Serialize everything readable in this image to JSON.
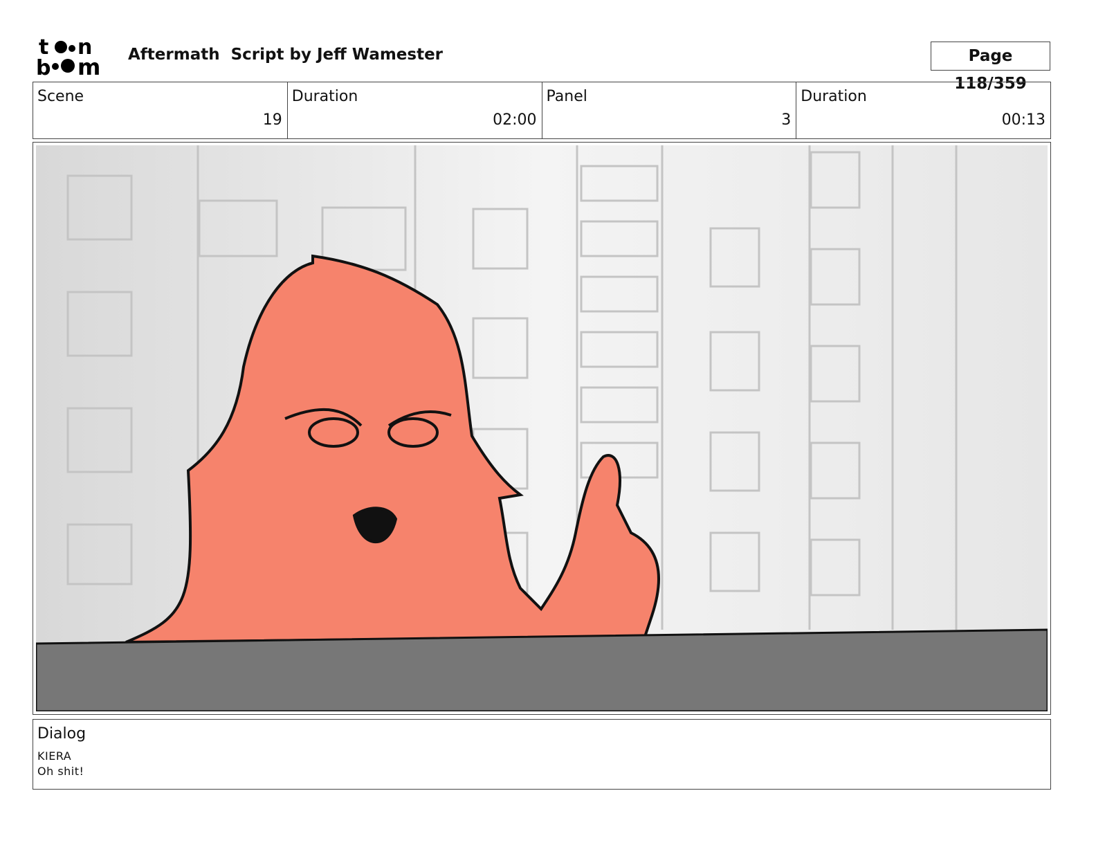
{
  "header": {
    "logo_text": "toon boom",
    "title": "Aftermath  Script by Jeff Wamester",
    "page": "Page 118/359"
  },
  "info": {
    "scene_label": "Scene",
    "scene": "19",
    "scene_duration_label": "Duration",
    "scene_duration": "02:00",
    "panel_label": "Panel",
    "panel": "3",
    "panel_duration_label": "Duration",
    "panel_duration": "00:13"
  },
  "dialog": {
    "label": "Dialog",
    "speaker": "KIERA",
    "line": "Oh shit!"
  },
  "colors": {
    "skin": "#f6836c",
    "ground": "#777777"
  }
}
